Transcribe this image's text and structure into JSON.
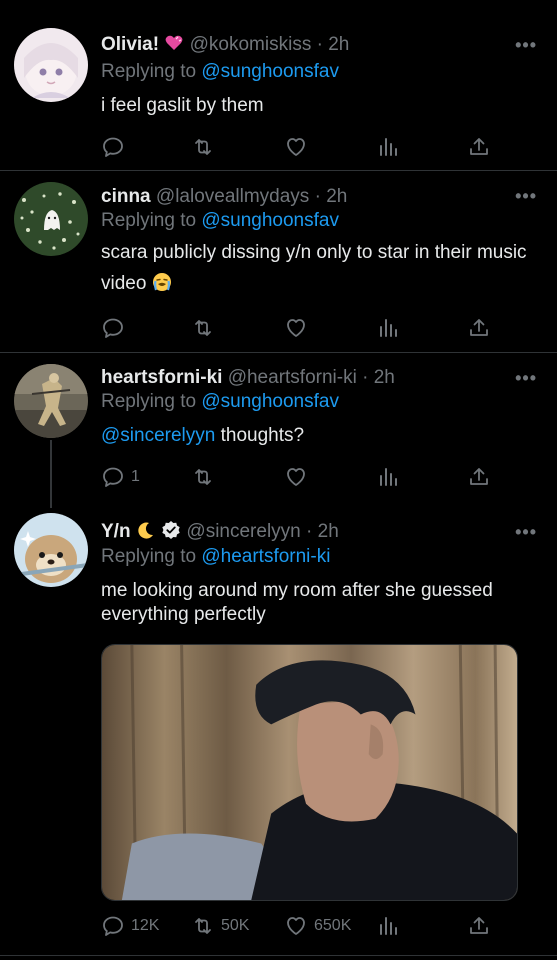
{
  "tweets": [
    {
      "name": "Olivia!",
      "name_emoji": "heart-emoji",
      "handle": "@kokomiskiss",
      "time": "2h",
      "replying_prefix": "Replying to",
      "replying_to": "@sunghoonsfav",
      "text": "i feel gaslit by them",
      "reply_count": "",
      "retweet_count": "",
      "like_count": ""
    },
    {
      "name": "cinna",
      "handle": "@laloveallmydays",
      "time": "2h",
      "replying_prefix": "Replying to",
      "replying_to": "@sunghoonsfav",
      "text": "scara publicly dissing y/n only to star in their music video",
      "text_emoji": "loudly-crying-emoji",
      "reply_count": "",
      "retweet_count": "",
      "like_count": ""
    },
    {
      "name": "heartsforni-ki",
      "handle": "@heartsforni-ki",
      "time": "2h",
      "replying_prefix": "Replying to",
      "replying_to": "@sunghoonsfav",
      "text_mention": "@sincerelyyn",
      "text": "thoughts?",
      "reply_count": "1",
      "retweet_count": "",
      "like_count": ""
    },
    {
      "name": "Y/n",
      "name_emoji": "crescent-moon-emoji",
      "verified": true,
      "handle": "@sincerelyyn",
      "time": "2h",
      "replying_prefix": "Replying to",
      "replying_to": "@heartsforni-ki",
      "text": "me looking around my room after she guessed everything perfectly",
      "reply_count": "12K",
      "retweet_count": "50K",
      "like_count": "650K"
    }
  ],
  "ui": {
    "separator": "·",
    "more_glyph": "•••"
  },
  "colors": {
    "background": "#000000",
    "text": "#e7e9ea",
    "secondary": "#71767b",
    "accent": "#1d9bf0",
    "divider": "#2f3336"
  }
}
